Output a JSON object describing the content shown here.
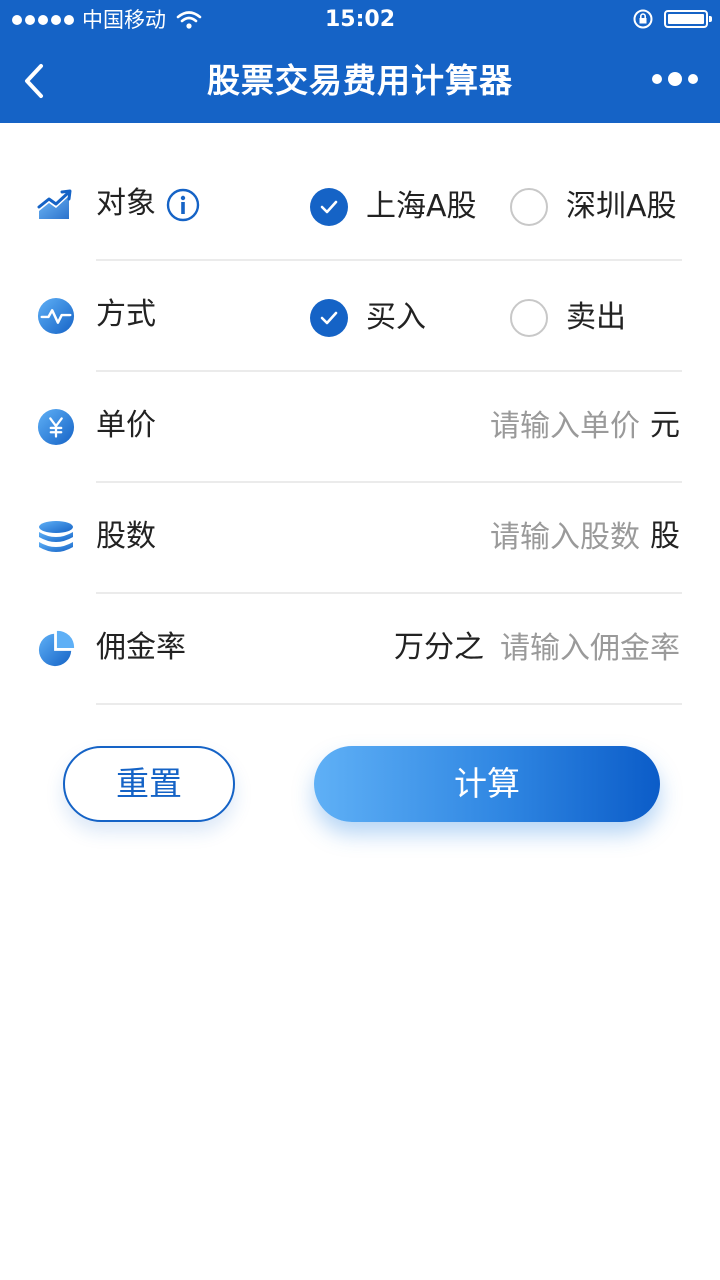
{
  "status_bar": {
    "carrier": "中国移动",
    "time": "15:02"
  },
  "nav": {
    "title": "股票交易费用计算器"
  },
  "form": {
    "target": {
      "label": "对象",
      "options": [
        {
          "label": "上海A股",
          "selected": true
        },
        {
          "label": "深圳A股",
          "selected": false
        }
      ]
    },
    "method": {
      "label": "方式",
      "options": [
        {
          "label": "买入",
          "selected": true
        },
        {
          "label": "卖出",
          "selected": false
        }
      ]
    },
    "price": {
      "label": "单价",
      "placeholder": "请输入单价",
      "value": "",
      "unit": "元"
    },
    "shares": {
      "label": "股数",
      "placeholder": "请输入股数",
      "value": "",
      "unit": "股"
    },
    "commission": {
      "label": "佣金率",
      "prefix": "万分之",
      "placeholder": "请输入佣金率",
      "value": ""
    }
  },
  "buttons": {
    "reset": "重置",
    "calculate": "计算"
  },
  "colors": {
    "primary": "#1563c6",
    "divider": "#ebebeb",
    "placeholder": "#9a9a9a"
  }
}
